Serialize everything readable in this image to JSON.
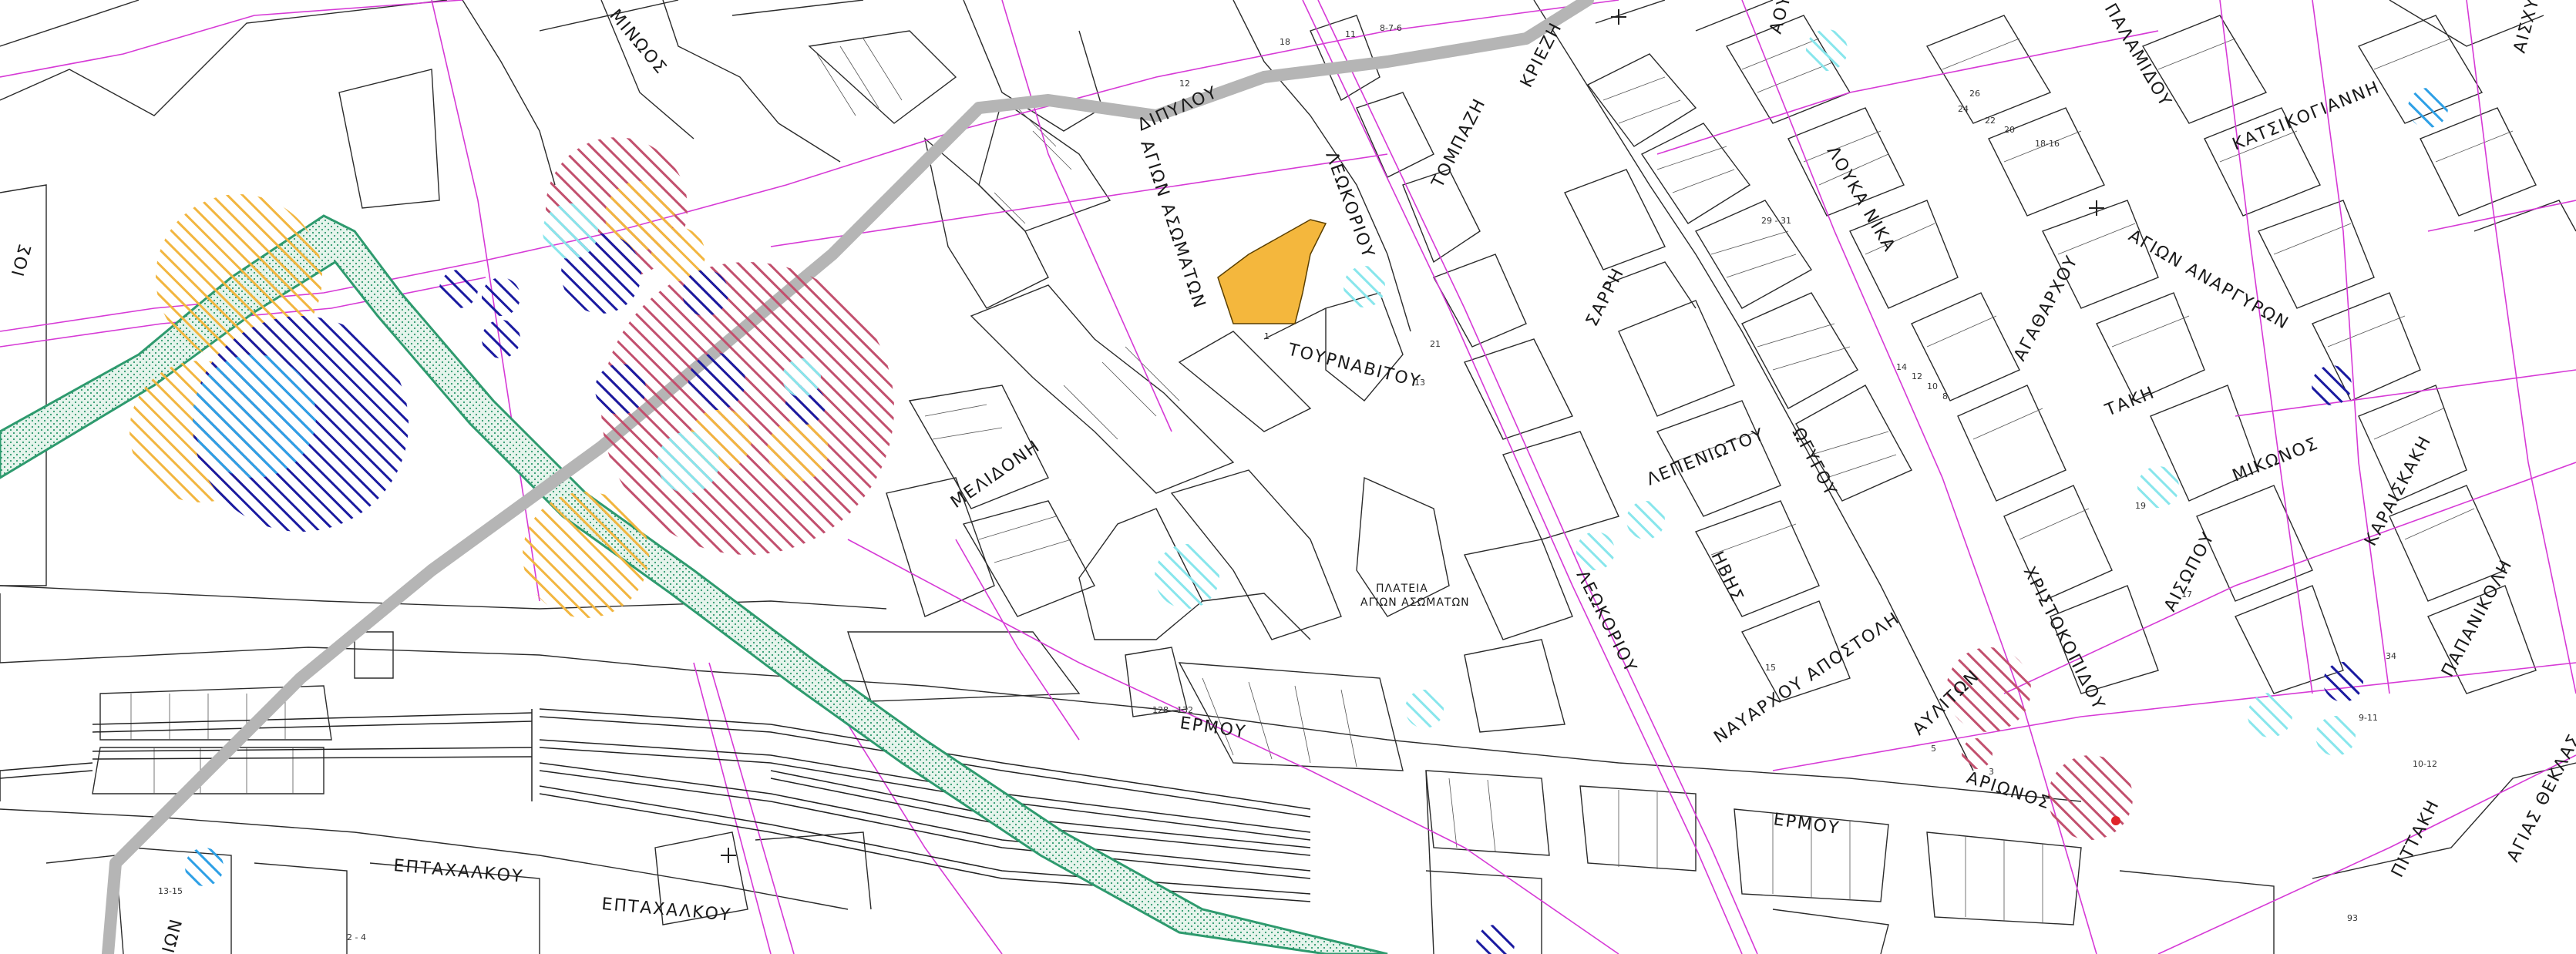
{
  "map": {
    "streets": [
      {
        "id": "minos",
        "text": "ΜΙΝΩΟΣ"
      },
      {
        "id": "dipylou",
        "text": "ΔΙΠΥΛΟΥ"
      },
      {
        "id": "agion-asomaton",
        "text": "ΑΓΙΩΝ ΑΣΩΜΑΤΩΝ"
      },
      {
        "id": "leokoriou-top",
        "text": "ΛΕΩΚΟΡΙΟΥ"
      },
      {
        "id": "tourn",
        "text": "ΤΟΥΡΝΑΒΙΤΟΥ"
      },
      {
        "id": "kriezi",
        "text": "ΚΡΙΕΖΗ"
      },
      {
        "id": "tompazi",
        "text": "ΤΟΜΠΑΖΗ"
      },
      {
        "id": "sarri",
        "text": "ΣΑΡΡΗ"
      },
      {
        "id": "lotka",
        "text": "ΛΟΥΚΑ ΝΙΚΑ"
      },
      {
        "id": "palamidou",
        "text": "ΠΑΛΑΜΙΔΟΥ"
      },
      {
        "id": "katsikogianni",
        "text": "ΚΑΤΣΙΚΟΓΙΑΝΝΗ"
      },
      {
        "id": "agion-anargyron",
        "text": "ΑΓΙΩΝ ΑΝΑΡΓΥΡΩΝ"
      },
      {
        "id": "agatharchou",
        "text": "ΑΓΑΘΑΡΧΟΥ"
      },
      {
        "id": "taki",
        "text": "ΤΑΚΗ"
      },
      {
        "id": "karaiskaki",
        "text": "ΚΑΡΑΙΣΚΑΚΗ"
      },
      {
        "id": "mikonos",
        "text": "ΜΙΚΩΝΟΣ"
      },
      {
        "id": "aisopou",
        "text": "ΑΙΣΩΠΟΥ"
      },
      {
        "id": "papanikoli",
        "text": "ΠΑΠΑΝΙΚΟΛΗ"
      },
      {
        "id": "christokopidou",
        "text": "ΧΡΙΣΤΟΚΟΠΙΔΟΥ"
      },
      {
        "id": "lepeniotou",
        "text": "ΛΕΠΕΝΙΩΤΟΥ"
      },
      {
        "id": "ogygou",
        "text": "ΩΓΥΓΟΥ"
      },
      {
        "id": "ivis",
        "text": "ΗΒΗΣ"
      },
      {
        "id": "leokoriou-mid",
        "text": "ΛΕΩΚΟΡΙΟΥ"
      },
      {
        "id": "navarchou",
        "text": "ΝΑΥΑΡΧΟΥ ΑΠΟΣΤΟΛΗ"
      },
      {
        "id": "avliton",
        "text": "ΑΥΛΙΤΩΝ"
      },
      {
        "id": "arionos",
        "text": "ΑΡΙΩΝΟΣ"
      },
      {
        "id": "melidoni",
        "text": "ΜΕΛΙΔΟΝΗ"
      },
      {
        "id": "ermou-left",
        "text": "ΕΡΜΟΥ"
      },
      {
        "id": "ermou-right",
        "text": "ΕΡΜΟΥ"
      },
      {
        "id": "eptachalkou-1",
        "text": "ΕΠΤΑΧΑΛΚΟΥ"
      },
      {
        "id": "eptachalkou-2",
        "text": "ΕΠΤΑΧΑΛΚΟΥ"
      },
      {
        "id": "agias-theklas",
        "text": "ΑΓΙΑΣ ΘΕΚΛΑΣ"
      },
      {
        "id": "pittaki",
        "text": "ΠΙΤΤΑΚΗ"
      },
      {
        "id": "aisxylou",
        "text": "ΑΙΣΧΥ"
      },
      {
        "id": "left-edge",
        "text": "ΙΟΣ"
      },
      {
        "id": "bottom-left",
        "text": "ΙΩΝ"
      },
      {
        "id": "top-aou",
        "text": "ΑΟΥ"
      }
    ],
    "places": [
      {
        "id": "plateia-l1",
        "text": "ΠΛΑΤΕΙΑ"
      },
      {
        "id": "plateia-l2",
        "text": "ΑΓΙΩΝ ΑΣΩΜΑΤΩΝ"
      }
    ],
    "numbers": [
      "12",
      "18",
      "11",
      "8-7-6",
      "1",
      "13",
      "128 - 132",
      "24",
      "26",
      "22",
      "20",
      "18-16",
      "14",
      "12",
      "10",
      "8",
      "29 - 31",
      "21",
      "19",
      "15",
      "5",
      "3",
      "13-15",
      "2 - 4",
      "93",
      "17",
      "34",
      "10-12",
      "9-11"
    ],
    "colors": {
      "background": "#ffffff",
      "blocks": "#2b2b2b",
      "property_lines": "#d63ad6",
      "route_gray": "#b5b5b5",
      "green_corridor": "#2e9a6e",
      "hatch_pink": "#c2506e",
      "hatch_orange": "#f2b640",
      "hatch_blue_dark": "#1a1aa0",
      "hatch_blue_light": "#2ea0e6",
      "hatch_cyan": "#88e6ec",
      "highlight_parcel": "#f4b73d"
    }
  }
}
